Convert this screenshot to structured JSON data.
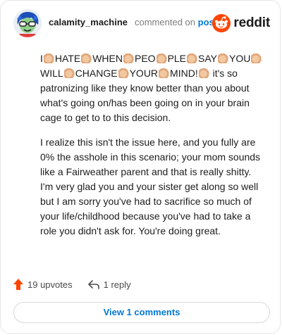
{
  "header": {
    "username": "calamity_machine",
    "action": "commented on",
    "post_link": "post",
    "brand": "reddit"
  },
  "comment": {
    "shout_words": [
      "I",
      "HATE",
      "WHEN",
      "PEO",
      "PLE",
      "SAY",
      "YOU",
      "WILL",
      "CHANGE",
      "YOUR",
      "MIND!"
    ],
    "shout_tail": "it's so patronizing like they know better than you about what's going on/has been going on in your brain cage to get to to this decision.",
    "paragraph2": "I realize this isn't the issue here, and you fully are 0% the asshole in this scenario; your mom sounds like a Fairweather parent and that is really shitty. I'm very glad you and your sister get along so well but I am sorry you've had to sacrifice so much of your life/childhood because you've had to take a role you didn't ask for. You're doing great."
  },
  "footer": {
    "upvotes": "19 upvotes",
    "replies": "1 reply",
    "view_comments": "View 1 comments"
  },
  "colors": {
    "accent": "#0079d3",
    "brand": "#ff4500",
    "upvote": "#ff4500"
  },
  "icons": {
    "avatar": "cartoon-avatar-icon",
    "reddit": "reddit-logo-icon",
    "upvote": "upvote-arrow-icon",
    "reply": "reply-arrow-icon",
    "emoji": "clapping-hands-icon"
  }
}
